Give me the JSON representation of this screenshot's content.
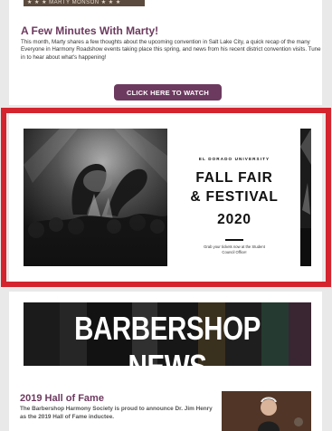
{
  "marty": {
    "strip_text": "★ ★ ★ MARTY MONSON ★ ★ ★",
    "title": "A Few Minutes With Marty!",
    "body": "This month, Marty shares a few thoughts about the upcoming convention in Salt Lake City, a quick recap of the many Everyone in Harmony Roadshow events taking place this spring, and news from his recent district convention visits. Tune in to hear about what's happening!",
    "button_label": "CLICK HERE TO WATCH"
  },
  "fair_banner": {
    "university": "EL DORADO UNIVERSITY",
    "line1": "FALL FAIR",
    "line2": "& FESTIVAL",
    "year": "2020",
    "tickets": "Grab your tickets now at the Student Council Office!"
  },
  "news": {
    "banner_title": "BARBERSHOP NEWS",
    "hof_title": "2019 Hall of Fame",
    "hof_body": "The Barbershop Harmony Society is proud to announce Dr. Jim Henry as the 2019 Hall of Fame inductee."
  },
  "colors": {
    "accent": "#6d3a5f",
    "highlight": "#d4242e",
    "background": "#e9e9e9"
  }
}
